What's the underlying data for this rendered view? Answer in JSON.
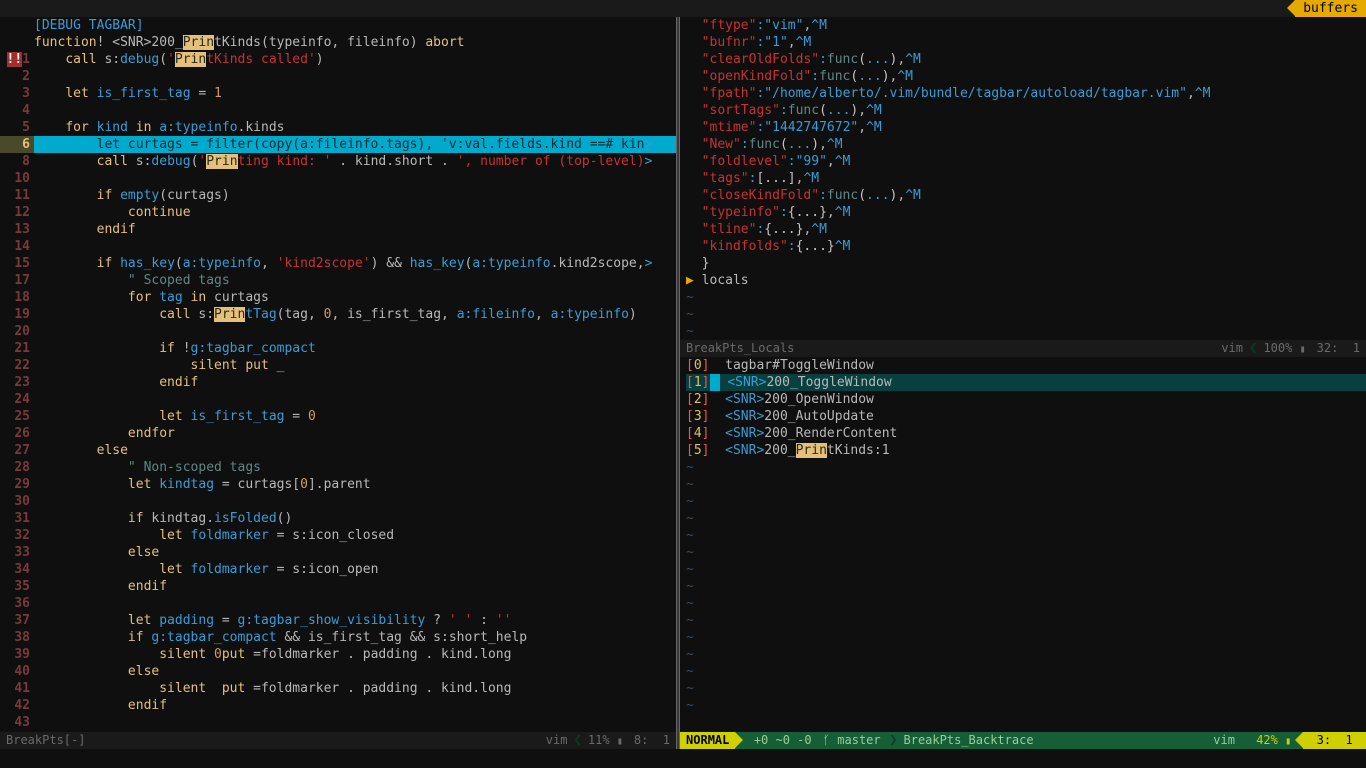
{
  "tabline": {
    "right": "buffers"
  },
  "left_pane": {
    "header": "[DEBUG TAGBAR]",
    "lines": [
      {
        "g": "",
        "html": "<span class='kw'>function</span>! &lt;SNR&gt;200_<span class='hi'>Prin</span>tKinds(typeinfo, fileinfo) <span class='kw'>abort</span>"
      },
      {
        "g": "!!1",
        "err": true,
        "html": "    <span class='kw'>call</span> s:<span class='fn'>debug</span>(<span class='str'>'</span><span class='hi'>Prin</span><span class='str'>tKinds called'</span>)"
      },
      {
        "g": "2",
        "html": ""
      },
      {
        "g": "3",
        "html": "    <span class='kw'>let</span> <span class='id'>is_first_tag</span> = <span class='num'>1</span>"
      },
      {
        "g": "4",
        "html": ""
      },
      {
        "g": "5",
        "html": "    <span class='kw'>for</span> <span class='id'>kind</span> <span class='kw'>in</span> <span class='fn'>a:typeinfo</span>.kinds"
      },
      {
        "g": "6",
        "cur": true,
        "hl": true,
        "html": "        let curtags = filter(copy(a:fileinfo.tags), 'v:val.fields.kind ==# kin<span class='trunc'>&gt;</span>"
      },
      {
        "g": "8",
        "html": "        <span class='kw'>call</span> s:<span class='fn'>debug</span>(<span class='str'>'</span><span class='hi'>Prin</span><span class='str'>ting kind: '</span> . kind.short . <span class='str'>', number of (top-level)</span><span class='trunc'>&gt;</span>"
      },
      {
        "g": "10",
        "html": ""
      },
      {
        "g": "11",
        "html": "        <span class='kw'>if</span> <span class='fn'>empty</span>(curtags)"
      },
      {
        "g": "12",
        "html": "            <span class='kw'>continue</span>"
      },
      {
        "g": "13",
        "html": "        <span class='kw'>endif</span>"
      },
      {
        "g": "14",
        "html": ""
      },
      {
        "g": "15",
        "html": "        <span class='kw'>if</span> <span class='fn'>has_key</span>(<span class='fn'>a:typeinfo</span>, <span class='str'>'kind2scope'</span>) && <span class='fn'>has_key</span>(<span class='fn'>a:typeinfo</span>.kind2scope,<span class='trunc'>&gt;</span>"
      },
      {
        "g": "17",
        "html": "            <span class='cmt'>\" Scoped tags</span>"
      },
      {
        "g": "18",
        "html": "            <span class='kw'>for</span> <span class='id'>tag</span> <span class='kw'>in</span> curtags"
      },
      {
        "g": "19",
        "html": "                <span class='kw'>call</span> s:<span class='hi'>Prin</span><span class='fn'>tTag</span>(tag, <span class='num'>0</span>, is_first_tag, <span class='fn'>a:fileinfo</span>, <span class='fn'>a:typeinfo</span>)"
      },
      {
        "g": "20",
        "html": ""
      },
      {
        "g": "21",
        "html": "                <span class='kw'>if</span> !<span class='fn'>g:tagbar_compact</span>"
      },
      {
        "g": "22",
        "html": "                    <span class='kw'>silent put</span> _"
      },
      {
        "g": "23",
        "html": "                <span class='kw'>endif</span>"
      },
      {
        "g": "24",
        "html": ""
      },
      {
        "g": "25",
        "html": "                <span class='kw'>let</span> <span class='id'>is_first_tag</span> = <span class='num'>0</span>"
      },
      {
        "g": "26",
        "html": "            <span class='kw'>endfor</span>"
      },
      {
        "g": "27",
        "html": "        <span class='kw'>else</span>"
      },
      {
        "g": "28",
        "html": "            <span class='cmt'>\" Non-scoped tags</span>"
      },
      {
        "g": "29",
        "html": "            <span class='kw'>let</span> <span class='id'>kindtag</span> = curtags[<span class='num'>0</span>].parent"
      },
      {
        "g": "30",
        "html": ""
      },
      {
        "g": "31",
        "html": "            <span class='kw'>if</span> kindtag.<span class='fn'>isFolded</span>()"
      },
      {
        "g": "32",
        "html": "                <span class='kw'>let</span> <span class='id'>foldmarker</span> = s:icon_closed"
      },
      {
        "g": "33",
        "html": "            <span class='kw'>else</span>"
      },
      {
        "g": "34",
        "html": "                <span class='kw'>let</span> <span class='id'>foldmarker</span> = s:icon_open"
      },
      {
        "g": "35",
        "html": "            <span class='kw'>endif</span>"
      },
      {
        "g": "36",
        "html": ""
      },
      {
        "g": "37",
        "html": "            <span class='kw'>let</span> <span class='id'>padding</span> = <span class='fn'>g:tagbar_show_visibility</span> ? <span class='str'>' '</span> : <span class='str'>''</span>"
      },
      {
        "g": "38",
        "html": "            <span class='kw'>if</span> <span class='fn'>g:tagbar_compact</span> && is_first_tag && s:short_help"
      },
      {
        "g": "39",
        "html": "                <span class='kw'>silent</span> <span class='num'>0</span><span class='kw'>put</span> =foldmarker . padding . kind.long"
      },
      {
        "g": "40",
        "html": "            <span class='kw'>else</span>"
      },
      {
        "g": "41",
        "html": "                <span class='kw'>silent  put</span> =foldmarker . padding . kind.long"
      },
      {
        "g": "42",
        "html": "            <span class='kw'>endif</span>"
      },
      {
        "g": "43",
        "html": ""
      }
    ],
    "status": {
      "file": "BreakPts[-]",
      "ft": "vim",
      "pct": "11%",
      "line": "8",
      "col": "1"
    }
  },
  "locals": {
    "entries": [
      {
        "k": "ftype",
        "v": "\"vim\""
      },
      {
        "k": "bufnr",
        "v": "\"1\""
      },
      {
        "k": "clearOldFolds",
        "func": true
      },
      {
        "k": "openKindFold",
        "func": true
      },
      {
        "k": "fpath",
        "v": "\"/home/alberto/.vim/bundle/tagbar/autoload/tagbar.vim\""
      },
      {
        "k": "sortTags",
        "func": true
      },
      {
        "k": "mtime",
        "v": "\"1442747672\""
      },
      {
        "k": "New",
        "func": true
      },
      {
        "k": "foldlevel",
        "v": "\"99\""
      },
      {
        "k": "tags",
        "raw": "[...]"
      },
      {
        "k": "closeKindFold",
        "func": true
      },
      {
        "k": "typeinfo",
        "raw": "{...}"
      },
      {
        "k": "tline",
        "raw": "{...}"
      },
      {
        "k": "kindfolds",
        "raw": "{...}",
        "noesc_trail": "^M"
      }
    ],
    "close": "}",
    "locals_label": "locals",
    "status": {
      "file": "BreakPts_Locals",
      "ft": "vim",
      "pct": "100%",
      "line": "32",
      "col": "1"
    }
  },
  "trace": {
    "items": [
      {
        "i": 0,
        "t": "tagbar#ToggleWindow"
      },
      {
        "i": 1,
        "t": "<SNR>200_ToggleWindow",
        "cur": true
      },
      {
        "i": 2,
        "t": "<SNR>200_OpenWindow"
      },
      {
        "i": 3,
        "t": "<SNR>200_AutoUpdate"
      },
      {
        "i": 4,
        "t": "<SNR>200_RenderContent"
      },
      {
        "i": 5,
        "t": "<SNR>200_PrintKinds:1",
        "hi_prin": true
      }
    ],
    "status": {
      "mode": "NORMAL",
      "hunks": "+0 ~0 -0",
      "branch": "master",
      "file": "BreakPts_Backtrace",
      "ft": "vim",
      "pct": "42%",
      "line": "3",
      "col": "1"
    }
  }
}
